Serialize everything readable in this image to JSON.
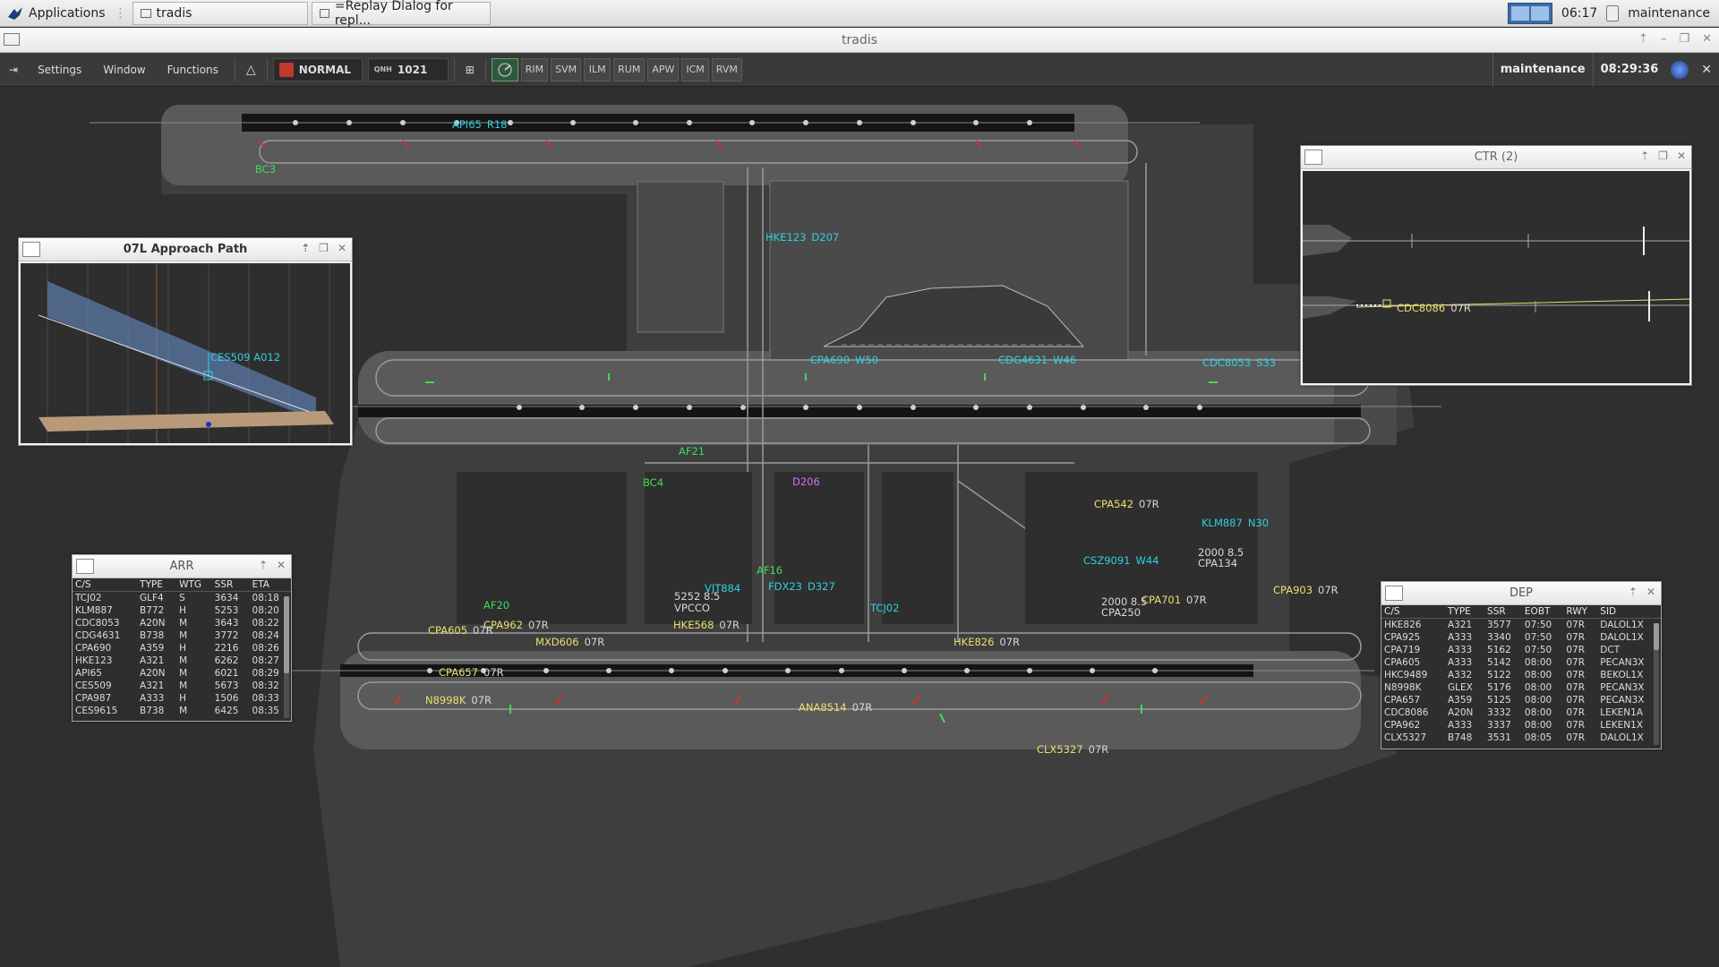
{
  "os": {
    "apps_label": "Applications",
    "tasks": [
      {
        "label": "tradis"
      },
      {
        "label": "=Replay Dialog for repl..."
      }
    ],
    "clock": "06:17",
    "user": "maintenance"
  },
  "window": {
    "title": "tradis"
  },
  "toolbar": {
    "menus": [
      "Settings",
      "Window",
      "Functions"
    ],
    "mode": "NORMAL",
    "qnh_label": "QNH",
    "qnh_value": "1021",
    "buttons": [
      "RIM",
      "SVM",
      "ILM",
      "RUM",
      "APW",
      "ICM",
      "RVM"
    ],
    "user": "maintenance",
    "clock": "08:29:36"
  },
  "colors": {
    "arrival": "#2fd0e0",
    "departure": "#e8e070",
    "ground": "#3ddc5c",
    "special": "#d070ff"
  },
  "map_tags": [
    {
      "cs": "API65",
      "info": "R18",
      "kind": "arr"
    },
    {
      "cs": "BC3",
      "info": "",
      "kind": "gnd"
    },
    {
      "cs": "HKE123",
      "info": "D207",
      "kind": "arr"
    },
    {
      "cs": "CPA690",
      "info": "W50",
      "kind": "arr"
    },
    {
      "cs": "CDG4631",
      "info": "W46",
      "kind": "arr"
    },
    {
      "cs": "CDC8053",
      "info": "S33",
      "kind": "arr"
    },
    {
      "cs": "AF21",
      "info": "",
      "kind": "gnd"
    },
    {
      "cs": "BC4",
      "info": "",
      "kind": "gnd"
    },
    {
      "cs": "D206",
      "info": "",
      "kind": "mag"
    },
    {
      "cs": "CPA542",
      "info": "07R",
      "kind": "dep"
    },
    {
      "cs": "KLM887",
      "info": "N30",
      "kind": "arr"
    },
    {
      "cs": "CSZ9091",
      "info": "W44",
      "kind": "arr"
    },
    {
      "cs": "2000  8.5",
      "info": "",
      "kind": "wht"
    },
    {
      "cs": "CPA134",
      "info": "",
      "kind": "wht"
    },
    {
      "cs": "CPA903",
      "info": "07R",
      "kind": "dep"
    },
    {
      "cs": "2000  8.5",
      "info": "",
      "kind": "wht"
    },
    {
      "cs": "CPA701",
      "info": "07R",
      "kind": "dep"
    },
    {
      "cs": "CPA250",
      "info": "",
      "kind": "wht"
    },
    {
      "cs": "AF16",
      "info": "",
      "kind": "gnd"
    },
    {
      "cs": "VJT884",
      "info": "",
      "kind": "arr"
    },
    {
      "cs": "FDX23",
      "info": "D327",
      "kind": "arr"
    },
    {
      "cs": "5252  8.5",
      "info": "",
      "kind": "wht"
    },
    {
      "cs": "VPCCO",
      "info": "",
      "kind": "wht"
    },
    {
      "cs": "TCJ02",
      "info": "",
      "kind": "arr"
    },
    {
      "cs": "AF20",
      "info": "",
      "kind": "gnd"
    },
    {
      "cs": "CPA605",
      "info": "07R",
      "kind": "dep"
    },
    {
      "cs": "CPA962",
      "info": "07R",
      "kind": "dep"
    },
    {
      "cs": "HKE568",
      "info": "07R",
      "kind": "dep"
    },
    {
      "cs": "MXD606",
      "info": "07R",
      "kind": "dep"
    },
    {
      "cs": "HKE826",
      "info": "07R",
      "kind": "dep"
    },
    {
      "cs": "CPA657",
      "info": "07R",
      "kind": "dep"
    },
    {
      "cs": "N8998K",
      "info": "07R",
      "kind": "dep"
    },
    {
      "cs": "ANA8514",
      "info": "07R",
      "kind": "dep"
    },
    {
      "cs": "CLX5327",
      "info": "07R",
      "kind": "dep"
    }
  ],
  "approach_panel": {
    "title": "07L Approach Path",
    "tag": "CES509  A012"
  },
  "ctr_panel": {
    "title": "CTR (2)",
    "tag": "CDC8086",
    "rwy": "07R"
  },
  "arr_panel": {
    "title": "ARR",
    "columns": [
      "C/S",
      "TYPE",
      "WTG",
      "SSR",
      "ETA"
    ],
    "rows": [
      [
        "TCJ02",
        "GLF4",
        "S",
        "3634",
        "08:18"
      ],
      [
        "KLM887",
        "B772",
        "H",
        "5253",
        "08:20"
      ],
      [
        "CDC8053",
        "A20N",
        "M",
        "3643",
        "08:22"
      ],
      [
        "CDG4631",
        "B738",
        "M",
        "3772",
        "08:24"
      ],
      [
        "CPA690",
        "A359",
        "H",
        "2216",
        "08:26"
      ],
      [
        "HKE123",
        "A321",
        "M",
        "6262",
        "08:27"
      ],
      [
        "API65",
        "A20N",
        "M",
        "6021",
        "08:29"
      ],
      [
        "CES509",
        "A321",
        "M",
        "5673",
        "08:32"
      ],
      [
        "CPA987",
        "A333",
        "H",
        "1506",
        "08:33"
      ],
      [
        "CES9615",
        "B738",
        "M",
        "6425",
        "08:35"
      ]
    ]
  },
  "dep_panel": {
    "title": "DEP",
    "columns": [
      "C/S",
      "TYPE",
      "SSR",
      "EOBT",
      "RWY",
      "SID"
    ],
    "rows": [
      [
        "HKE826",
        "A321",
        "3577",
        "07:50",
        "07R",
        "DALOL1X"
      ],
      [
        "CPA925",
        "A333",
        "3340",
        "07:50",
        "07R",
        "DALOL1X"
      ],
      [
        "CPA719",
        "A333",
        "5162",
        "07:50",
        "07R",
        "DCT"
      ],
      [
        "CPA605",
        "A333",
        "5142",
        "08:00",
        "07R",
        "PECAN3X"
      ],
      [
        "HKC9489",
        "A332",
        "5122",
        "08:00",
        "07R",
        "BEKOL1X"
      ],
      [
        "N8998K",
        "GLEX",
        "5176",
        "08:00",
        "07R",
        "PECAN3X"
      ],
      [
        "CPA657",
        "A359",
        "5125",
        "08:00",
        "07R",
        "PECAN3X"
      ],
      [
        "CDC8086",
        "A20N",
        "3332",
        "08:00",
        "07R",
        "LEKEN1A"
      ],
      [
        "CPA962",
        "A333",
        "3337",
        "08:00",
        "07R",
        "LEKEN1X"
      ],
      [
        "CLX5327",
        "B748",
        "3531",
        "08:05",
        "07R",
        "DALOL1X"
      ]
    ]
  }
}
